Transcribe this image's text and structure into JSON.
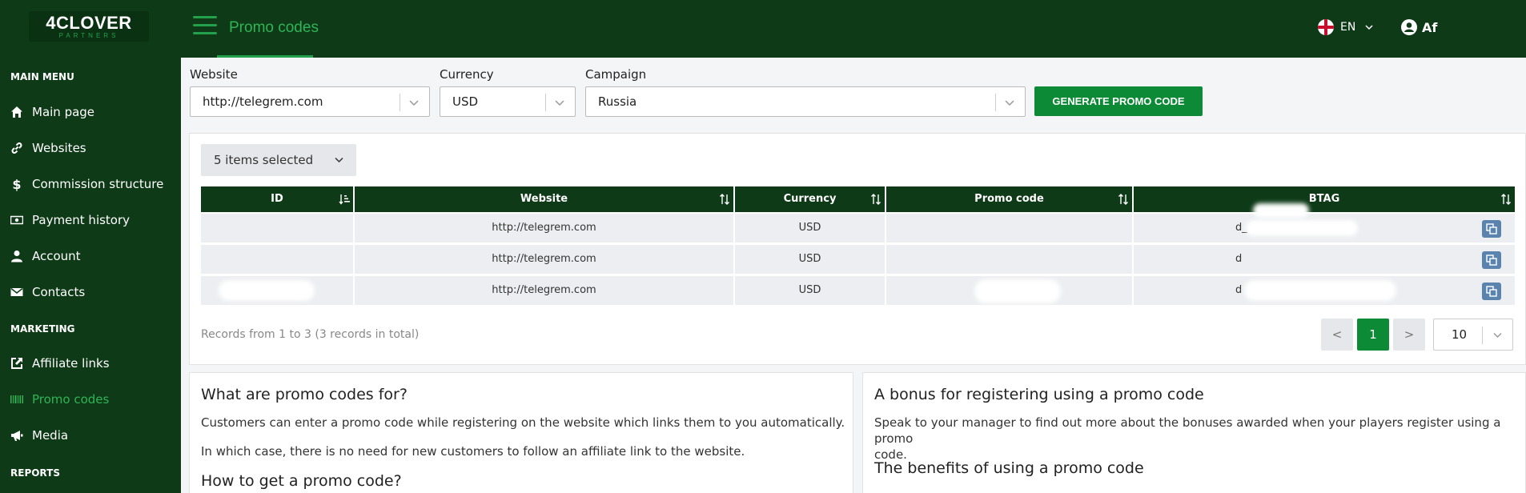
{
  "logo": {
    "main": "4CLOVER",
    "sub": "PARTNERS"
  },
  "colors": {
    "brand_dark": "#0e3a17",
    "accent": "#22a04b",
    "button": "#0d8a35",
    "copy": "#5a83ad"
  },
  "sidebar": {
    "sections": {
      "main": "MAIN MENU",
      "marketing": "MARKETING",
      "reports": "REPORTS"
    },
    "items": [
      {
        "label": "Main page",
        "icon": "home-icon"
      },
      {
        "label": "Websites",
        "icon": "link-icon"
      },
      {
        "label": "Commission structure",
        "icon": "dollar-icon"
      },
      {
        "label": "Payment history",
        "icon": "money-icon"
      },
      {
        "label": "Account",
        "icon": "user-icon"
      },
      {
        "label": "Contacts",
        "icon": "envelope-icon"
      },
      {
        "label": "Affiliate links",
        "icon": "external-link-icon"
      },
      {
        "label": "Promo codes",
        "icon": "barcode-icon",
        "active": true
      },
      {
        "label": "Media",
        "icon": "megaphone-icon"
      }
    ]
  },
  "header": {
    "title": "Promo codes",
    "lang": "EN",
    "user": "Af"
  },
  "filters": {
    "website": {
      "label": "Website",
      "value": "http://telegrem.com"
    },
    "currency": {
      "label": "Currency",
      "value": "USD"
    },
    "campaign": {
      "label": "Campaign",
      "value": "Russia"
    },
    "generate": "GENERATE PROMO CODE"
  },
  "table": {
    "selector": "5 items selected",
    "columns": [
      "ID",
      "Website",
      "Currency",
      "Promo code",
      "BTAG"
    ],
    "rows": [
      {
        "website": "http://telegrem.com",
        "currency": "USD",
        "btag": "d_"
      },
      {
        "website": "http://telegrem.com",
        "currency": "USD",
        "btag": "d"
      },
      {
        "website": "http://telegrem.com",
        "currency": "USD",
        "btag": "d"
      }
    ],
    "records": "Records from 1 to 3 (3 records in total)",
    "pagination": {
      "prev": "<",
      "current": "1",
      "next": ">",
      "per_page": "10"
    }
  },
  "info": {
    "left": {
      "h1": "What are promo codes for?",
      "p1": "Customers can enter a promo code while registering on the website which links them to you automatically.",
      "p2": "In which case, there is no need for new customers to follow an affiliate link to the website.",
      "h2": "How to get a promo code?"
    },
    "right": {
      "h1": "A bonus for registering using a promo code",
      "p1a": "Speak to your manager to find out more about the bonuses awarded when your players register using a promo",
      "p1b": "code.",
      "h2": "The benefits of using a promo code"
    }
  }
}
